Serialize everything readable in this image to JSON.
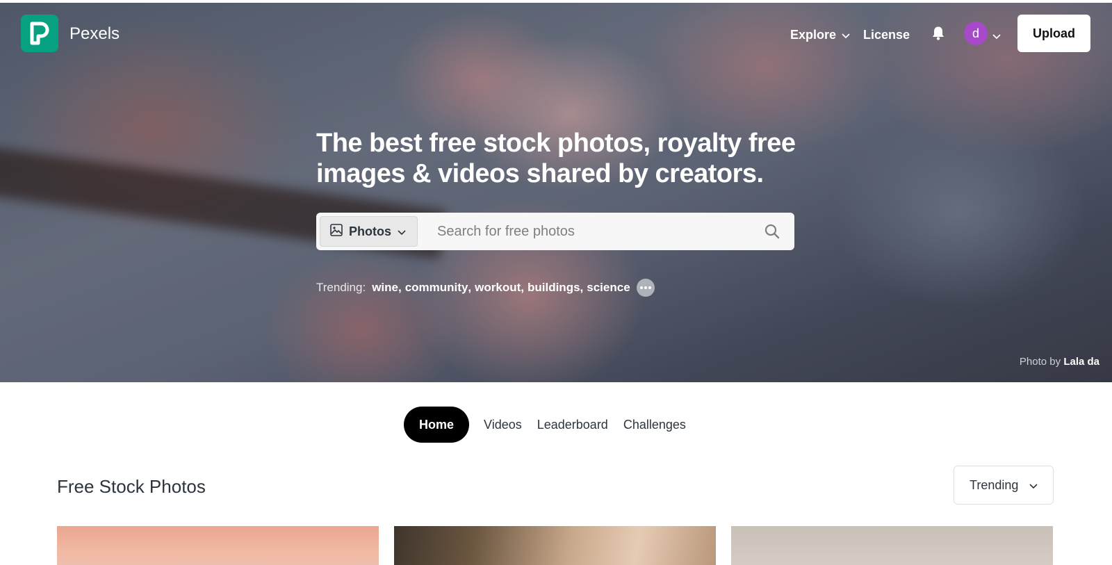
{
  "nav": {
    "brand": "Pexels",
    "explore": "Explore",
    "license": "License",
    "avatar_letter": "d",
    "upload": "Upload"
  },
  "hero": {
    "headline": "The best free stock photos, royalty free images & videos shared by creators.",
    "search_type": "Photos",
    "search_placeholder": "Search for free photos",
    "trending_label": "Trending:",
    "trending": [
      "wine",
      "community",
      "workout",
      "buildings",
      "science"
    ],
    "credit_prefix": "Photo by",
    "credit_name": "Lala da"
  },
  "tabs": [
    {
      "label": "Home",
      "active": true
    },
    {
      "label": "Videos",
      "active": false
    },
    {
      "label": "Leaderboard",
      "active": false
    },
    {
      "label": "Challenges",
      "active": false
    }
  ],
  "section": {
    "title": "Free Stock Photos",
    "sort": "Trending"
  },
  "colors": {
    "brand": "#07a081",
    "avatar": "#a64ac9",
    "tab_active": "#000000"
  },
  "icons": [
    "pexels-logo-icon",
    "chevron-down-icon",
    "bell-icon",
    "image-icon",
    "search-icon",
    "more-icon"
  ]
}
